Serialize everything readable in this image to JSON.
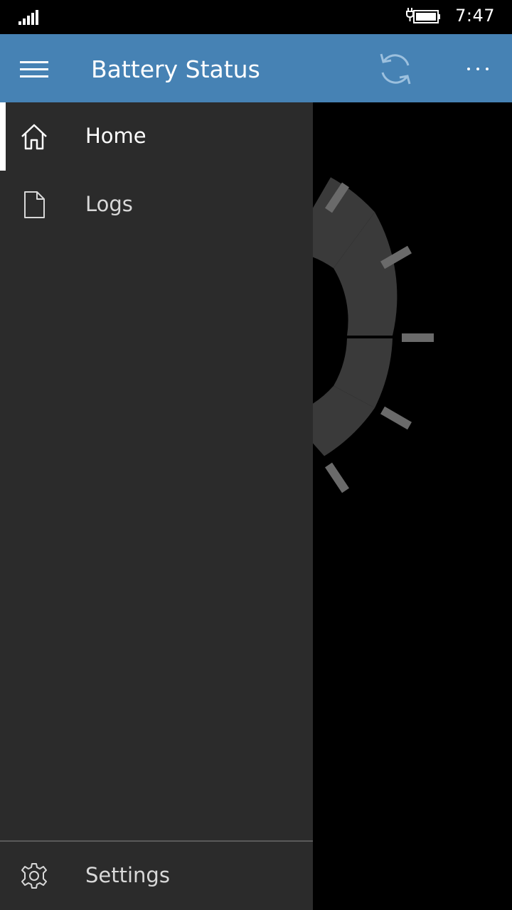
{
  "status_bar": {
    "time": "7:47",
    "signal_icon": "signal-bars-icon",
    "battery_icon": "battery-charging-icon"
  },
  "header": {
    "title": "Battery Status",
    "menu_icon": "hamburger-icon",
    "sync_icon": "sync-icon",
    "more_icon": "more-ellipsis-icon",
    "background_color": "#4682b4"
  },
  "nav": {
    "items": [
      {
        "label": "Home",
        "icon": "home-icon",
        "selected": true
      },
      {
        "label": "Logs",
        "icon": "document-icon",
        "selected": false
      }
    ],
    "footer_item": {
      "label": "Settings",
      "icon": "gear-icon"
    }
  },
  "colors": {
    "pane_background": "#2b2b2b",
    "gauge_segment": "#3a3a3a",
    "gauge_tick": "#6a6a6a"
  }
}
